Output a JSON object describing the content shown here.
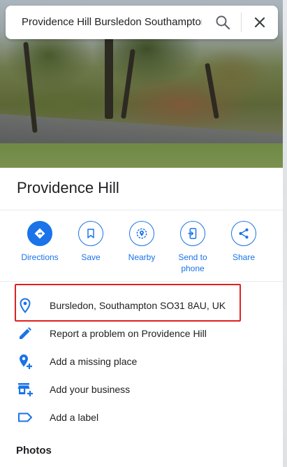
{
  "search": {
    "query": "Providence Hill Bursledon Southampton",
    "search_icon": "search-icon",
    "close_icon": "close-icon"
  },
  "place": {
    "title": "Providence Hill"
  },
  "actions": [
    {
      "label": "Directions",
      "icon": "directions-icon"
    },
    {
      "label": "Save",
      "icon": "bookmark-icon"
    },
    {
      "label": "Nearby",
      "icon": "nearby-icon"
    },
    {
      "label": "Send to phone",
      "icon": "send-to-phone-icon"
    },
    {
      "label": "Share",
      "icon": "share-icon"
    }
  ],
  "details": [
    {
      "text": "Bursledon, Southampton SO31 8AU, UK",
      "icon": "location-pin-icon"
    },
    {
      "text": "Report a problem on Providence Hill",
      "icon": "edit-pencil-icon"
    },
    {
      "text": "Add a missing place",
      "icon": "add-place-icon"
    },
    {
      "text": "Add your business",
      "icon": "add-business-icon"
    },
    {
      "text": "Add a label",
      "icon": "label-icon"
    }
  ],
  "sections": {
    "photos_heading": "Photos"
  },
  "colors": {
    "accent": "#1a73e8",
    "highlight_box": "#e02020",
    "text": "#202124"
  }
}
